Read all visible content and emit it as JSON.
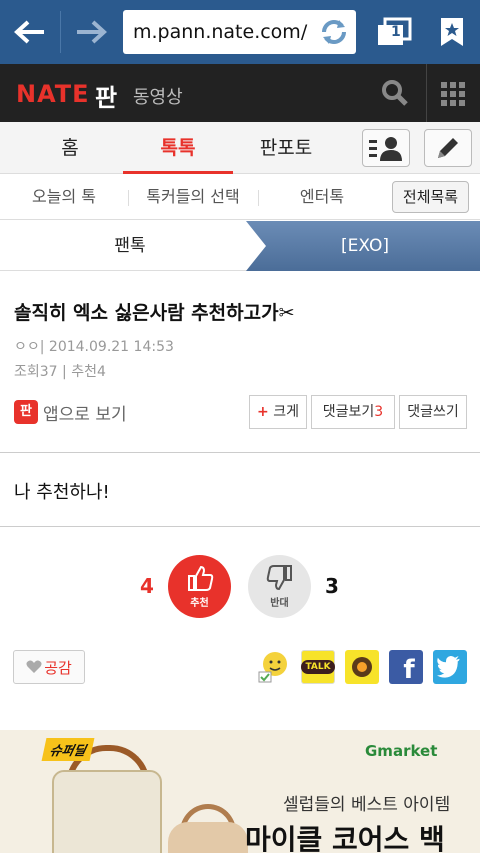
{
  "browser": {
    "url": "m.pann.nate.com/",
    "tab_count": "1"
  },
  "header": {
    "logo": "NATE",
    "pan": "판",
    "video": "동영상"
  },
  "main_tabs": [
    {
      "label": "홈"
    },
    {
      "label": "톡톡"
    },
    {
      "label": "판포토"
    }
  ],
  "sub_tabs": [
    {
      "label": "오늘의 톡"
    },
    {
      "label": "톡커들의 선택"
    },
    {
      "label": "엔터톡"
    }
  ],
  "all_list_label": "전체목록",
  "breadcrumb": {
    "left": "팬톡",
    "right": "[EXO]"
  },
  "post": {
    "title": "솔직히 엑소 싫은사람 추천하고가✂",
    "author_date": "ㅇㅇ|  2014.09.21 14:53",
    "stats": "조회37 | 추천4",
    "app_icon": "판",
    "app_view": "앱으로 보기",
    "bigger_label": "크게",
    "bigger_plus": "+",
    "comments_label": "댓글보기",
    "comments_count": "3",
    "write_comment": "댓글쓰기",
    "body": "나 추천하나!"
  },
  "votes": {
    "up_count": "4",
    "up_label": "추천",
    "down_count": "3",
    "down_label": "반대"
  },
  "empathy_label": "공감",
  "share_icons": [
    "emoticon",
    "kakaotalk",
    "kakaostory",
    "facebook",
    "twitter"
  ],
  "share_text": {
    "kakaotalk": "TALK",
    "facebook": "f"
  },
  "ad": {
    "badge": "슈퍼딜",
    "brand": "Gmarket",
    "line1": "셀럽들의 베스트 아이템",
    "line2": "마이클 코어스 백"
  },
  "colors": {
    "browser_blue": "#2b5a8e",
    "nate_red": "#e8322b",
    "crumb_blue": "#5a7ca8"
  }
}
